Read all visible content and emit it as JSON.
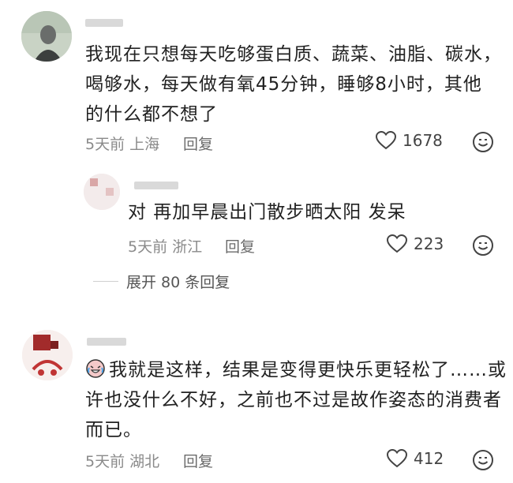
{
  "comments": [
    {
      "lines": [
        "我现在只想每天吃够蛋白质、蔬菜、油脂、碳水，",
        "喝够水，每天做有氧45分钟，睡够8小时，其他",
        "的什么都不想了"
      ],
      "time": "5天前",
      "location": "上海",
      "reply_label": "回复",
      "likes": "1678"
    },
    {
      "lines": [
        "对 再加早晨出门散步晒太阳 发呆"
      ],
      "time": "5天前",
      "location": "浙江",
      "reply_label": "回复",
      "likes": "223"
    },
    {
      "lines": [
        "我就是这样，结果是变得更快乐更轻松了……或",
        "许也没什么不好，之前也不过是故作姿态的消费者",
        "而已。"
      ],
      "time": "5天前",
      "location": "湖北",
      "reply_label": "回复",
      "likes": "412"
    }
  ],
  "expand_replies": "展开 80 条回复",
  "icons": {
    "like": "heart-outline-icon",
    "emoji": "smiley-emoji-icon",
    "inline": "crying-laugh-emoji-icon"
  }
}
